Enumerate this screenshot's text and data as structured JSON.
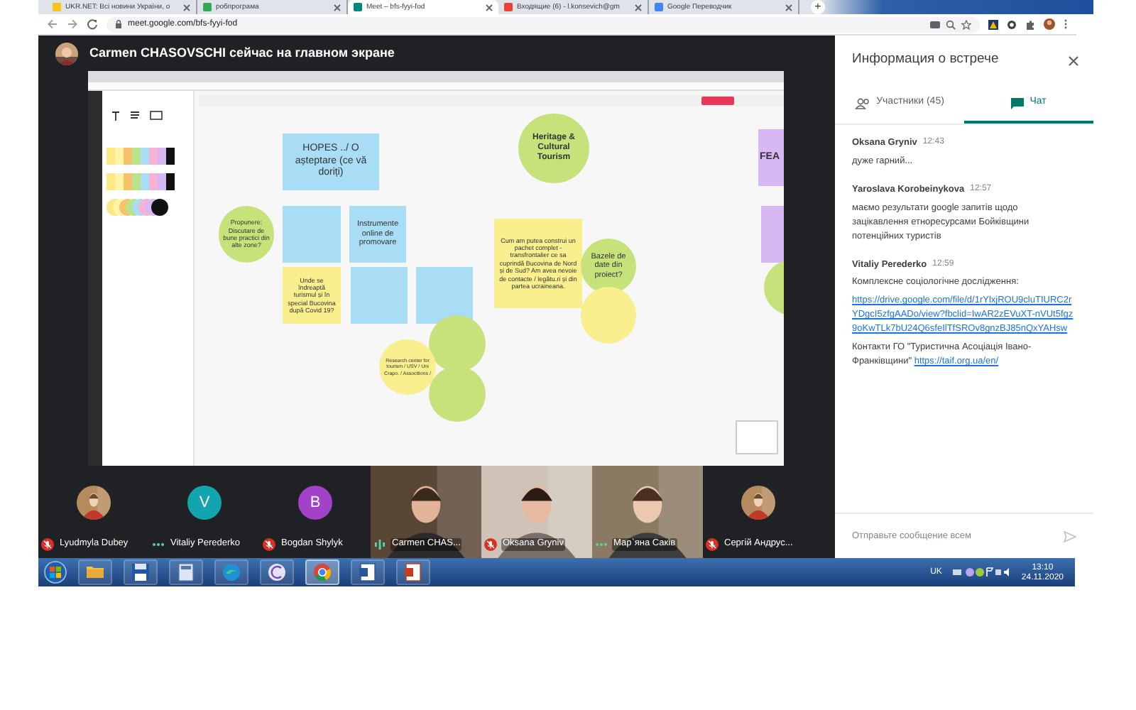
{
  "browser": {
    "tabs": [
      {
        "title": "UKR.NET: Всі новини України, о",
        "selected": false
      },
      {
        "title": "робпрограма",
        "selected": false
      },
      {
        "title": "Meet – bfs-fyyi-fod",
        "selected": true
      },
      {
        "title": "Входящие (6) - l.konsevich@gm",
        "selected": false
      },
      {
        "title": "Google Переводчик",
        "selected": false
      }
    ],
    "new_tab": "+",
    "url": "meet.google.com/bfs-fyyi-fod"
  },
  "meet": {
    "presenter_banner": "Carmen CHASOVSCHI сейчас на главном экране",
    "board": {
      "notes": [
        {
          "kind": "rect",
          "color": "#a9dcf5",
          "text": "HOPES ../ O așteptare (ce vă doriți)"
        },
        {
          "kind": "circle",
          "color": "#c7e27a",
          "text": "Propunere: Discutare de bune practici din alte zone?"
        },
        {
          "kind": "rect",
          "color": "#a9dcf5"
        },
        {
          "kind": "rect",
          "color": "#a9dcf5",
          "text": "Instrumente online de promovare"
        },
        {
          "kind": "rect",
          "color": "#f9ef8e",
          "text": "Unde se îndreaptă turismul și în special Bucovina după Covid 19?"
        },
        {
          "kind": "rect",
          "color": "#a9dcf5"
        },
        {
          "kind": "rect",
          "color": "#a9dcf5"
        },
        {
          "kind": "circle",
          "color": "#c7e27a"
        },
        {
          "kind": "circle",
          "color": "#c7e27a"
        },
        {
          "kind": "circle",
          "color": "#f9ef8e",
          "text": "Research center for tourism / USV / Uni Crapo. / Associtions /"
        },
        {
          "kind": "circle",
          "color": "#c7e27a",
          "text": "Heritage & Cultural Tourism"
        },
        {
          "kind": "rect",
          "color": "#f9ef8e",
          "text": "Cum am putea construi un pachet complet - transfrontalier ce sa cuprindă Bucovina de Nord și de Sud? Am avea nevoie de contacte / legătu.ri și din partea ucraineana."
        },
        {
          "kind": "circle",
          "color": "#c7e27a",
          "text": "Bazele de date din proiect?"
        },
        {
          "kind": "circle",
          "color": "#f9ef8e"
        },
        {
          "kind": "rect",
          "color": "#d7b8f3",
          "text": "FEA"
        },
        {
          "kind": "rect",
          "color": "#d7b8f3"
        },
        {
          "kind": "circle",
          "color": "#c7e27a"
        }
      ]
    }
  },
  "participants": [
    {
      "name": "Lyudmyla Dubey",
      "muted": true
    },
    {
      "name": "Vitaliy Perederko",
      "kind": "letter",
      "letter": "V",
      "color": "#12a4af",
      "muted": false,
      "speaking": false
    },
    {
      "name": "Bogdan Shylyk",
      "kind": "letter",
      "letter": "B",
      "color": "#a142c8",
      "muted": true
    },
    {
      "name": "Carmen CHAS...",
      "kind": "video",
      "muted": false,
      "speaking": true
    },
    {
      "name": "Oksana Gryniv",
      "kind": "video",
      "muted": true
    },
    {
      "name": "Мар`яна Саків",
      "kind": "video",
      "muted": false,
      "speaking": false
    },
    {
      "name": "Сергій Андрус...",
      "muted": true
    }
  ],
  "panel": {
    "title": "Информация о встрече",
    "tabs": [
      {
        "label": "Участники (45)",
        "selected": false
      },
      {
        "label": "Чат",
        "selected": true
      }
    ],
    "messages": [
      {
        "author": "Oksana Gryniv",
        "time": "12:43",
        "paragraphs": [
          {
            "text": "дуже гарний..."
          }
        ]
      },
      {
        "author": "Yaroslava Korobeinykova",
        "time": "12:57",
        "paragraphs": [
          {
            "text": "маємо результати google запитів щодо зацікавлення етноресурсами Бойківщини потенційних туристів"
          }
        ]
      },
      {
        "author": "Vitaliy Perederko",
        "time": "12:59",
        "paragraphs": [
          {
            "text": "Комплексне соціологічне дослідження:"
          },
          {
            "link": "https://drive.google.com/file/d/1rYlxjROU9cluTIURC2rYDgcI5zfgAADo/view?fbclid=IwAR2zEVuXT-nVUt5fgz9oKwTLk7bU24Q6sfeIlTfSROv8gnzBJ85nQxYAHsw"
          },
          {
            "text": "Контакти ГО \"Туристична Асоціація Івано-Франківщини\"",
            "link": "https://taif.org.ua/en/"
          }
        ]
      }
    ],
    "input": {
      "placeholder": "Отправьте сообщение всем"
    }
  },
  "taskbar": {
    "language": "UK",
    "time": "13:10",
    "date": "24.11.2020"
  }
}
